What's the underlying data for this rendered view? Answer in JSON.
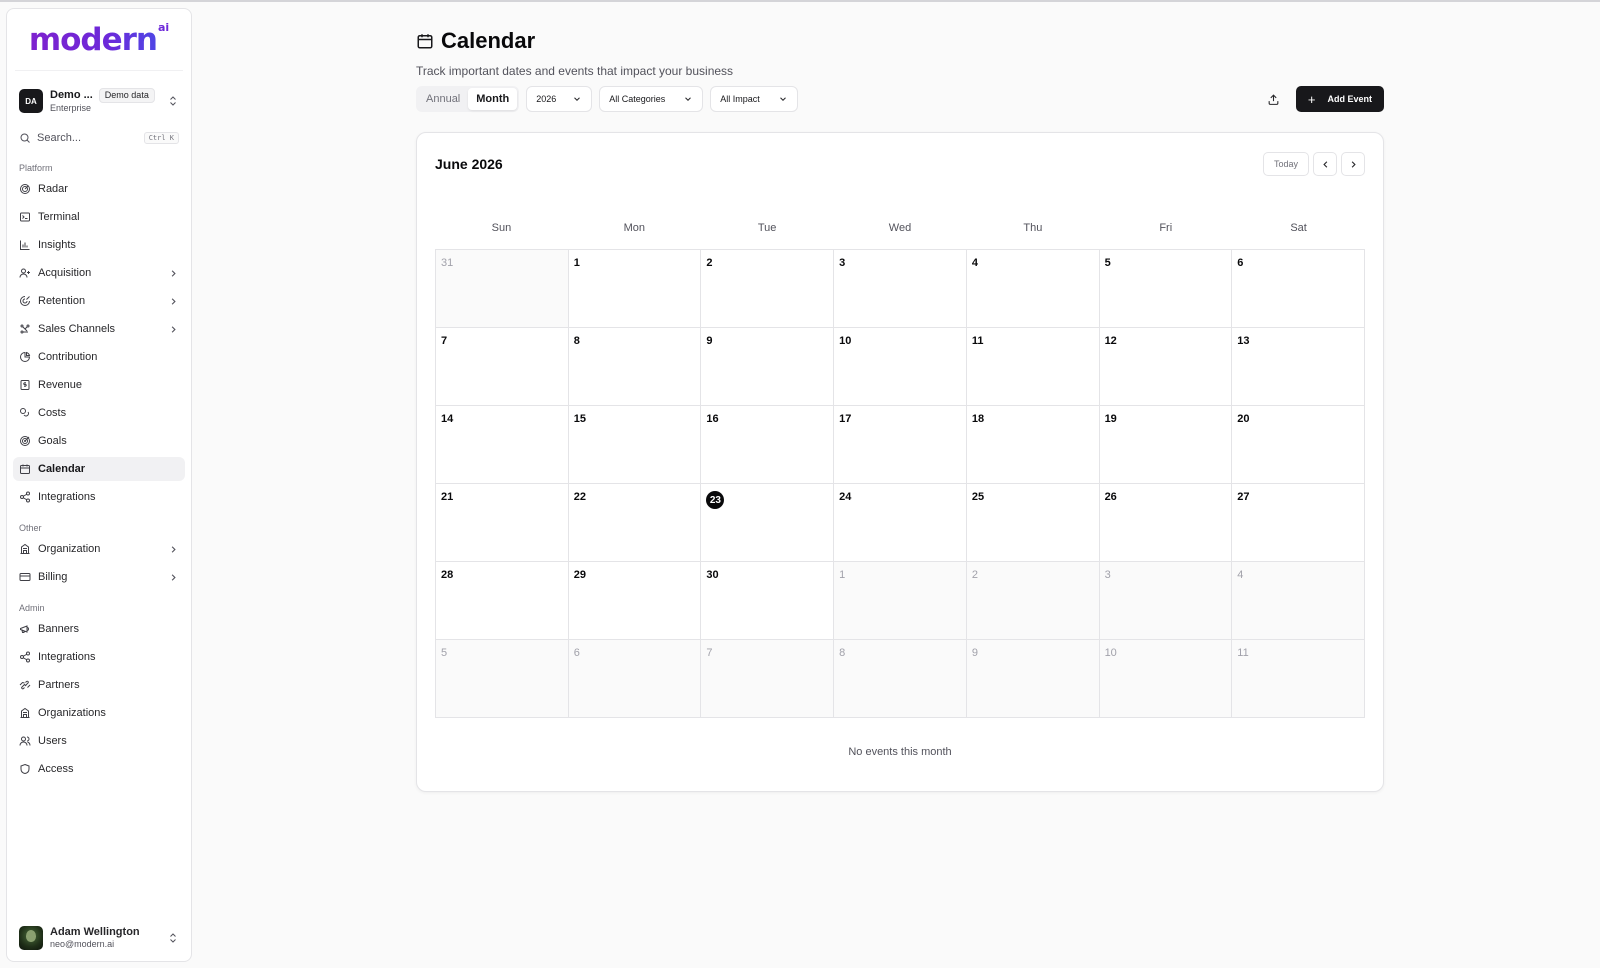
{
  "brand": {
    "name": "modern",
    "sup": "ai"
  },
  "org": {
    "initials": "DA",
    "name": "Demo ...",
    "badge": "Demo data",
    "plan": "Enterprise"
  },
  "search": {
    "placeholder": "Search...",
    "shortcut": "Ctrl K"
  },
  "sidebar": {
    "platform_label": "Platform",
    "platform": [
      {
        "label": "Radar",
        "icon": "radar-icon"
      },
      {
        "label": "Terminal",
        "icon": "terminal-icon"
      },
      {
        "label": "Insights",
        "icon": "bar-chart-icon"
      },
      {
        "label": "Acquisition",
        "icon": "user-plus-icon",
        "chevron": true
      },
      {
        "label": "Retention",
        "icon": "retention-icon",
        "chevron": true
      },
      {
        "label": "Sales Channels",
        "icon": "channels-icon",
        "chevron": true
      },
      {
        "label": "Contribution",
        "icon": "pie-chart-icon"
      },
      {
        "label": "Revenue",
        "icon": "revenue-icon"
      },
      {
        "label": "Costs",
        "icon": "coins-icon"
      },
      {
        "label": "Goals",
        "icon": "goal-icon"
      },
      {
        "label": "Calendar",
        "icon": "calendar-icon",
        "active": true
      },
      {
        "label": "Integrations",
        "icon": "share-icon"
      }
    ],
    "other_label": "Other",
    "other": [
      {
        "label": "Organization",
        "icon": "building-icon",
        "chevron": true
      },
      {
        "label": "Billing",
        "icon": "credit-card-icon",
        "chevron": true
      }
    ],
    "admin_label": "Admin",
    "admin": [
      {
        "label": "Banners",
        "icon": "megaphone-icon"
      },
      {
        "label": "Integrations",
        "icon": "share-icon"
      },
      {
        "label": "Partners",
        "icon": "handshake-icon"
      },
      {
        "label": "Organizations",
        "icon": "building-icon"
      },
      {
        "label": "Users",
        "icon": "users-icon"
      },
      {
        "label": "Access",
        "icon": "shield-icon"
      }
    ]
  },
  "user": {
    "name": "Adam Wellington",
    "email": "neo@modern.ai"
  },
  "page": {
    "title": "Calendar",
    "subtitle": "Track important dates and events that impact your business"
  },
  "toolbar": {
    "view_annual": "Annual",
    "view_month": "Month",
    "year": "2026",
    "category": "All Categories",
    "impact": "All Impact",
    "add_event": "Add Event"
  },
  "calendar": {
    "month_title": "June 2026",
    "today_label": "Today",
    "weekdays": [
      "Sun",
      "Mon",
      "Tue",
      "Wed",
      "Thu",
      "Fri",
      "Sat"
    ],
    "days": [
      {
        "n": "31",
        "muted": true
      },
      {
        "n": "1"
      },
      {
        "n": "2"
      },
      {
        "n": "3"
      },
      {
        "n": "4"
      },
      {
        "n": "5"
      },
      {
        "n": "6"
      },
      {
        "n": "7"
      },
      {
        "n": "8"
      },
      {
        "n": "9"
      },
      {
        "n": "10"
      },
      {
        "n": "11"
      },
      {
        "n": "12"
      },
      {
        "n": "13"
      },
      {
        "n": "14"
      },
      {
        "n": "15"
      },
      {
        "n": "16"
      },
      {
        "n": "17"
      },
      {
        "n": "18"
      },
      {
        "n": "19"
      },
      {
        "n": "20"
      },
      {
        "n": "21"
      },
      {
        "n": "22"
      },
      {
        "n": "23",
        "today": true
      },
      {
        "n": "24"
      },
      {
        "n": "25"
      },
      {
        "n": "26"
      },
      {
        "n": "27"
      },
      {
        "n": "28"
      },
      {
        "n": "29"
      },
      {
        "n": "30"
      },
      {
        "n": "1",
        "muted": true
      },
      {
        "n": "2",
        "muted": true
      },
      {
        "n": "3",
        "muted": true
      },
      {
        "n": "4",
        "muted": true
      },
      {
        "n": "5",
        "muted": true
      },
      {
        "n": "6",
        "muted": true
      },
      {
        "n": "7",
        "muted": true
      },
      {
        "n": "8",
        "muted": true
      },
      {
        "n": "9",
        "muted": true
      },
      {
        "n": "10",
        "muted": true
      },
      {
        "n": "11",
        "muted": true
      }
    ],
    "empty_message": "No events this month"
  }
}
